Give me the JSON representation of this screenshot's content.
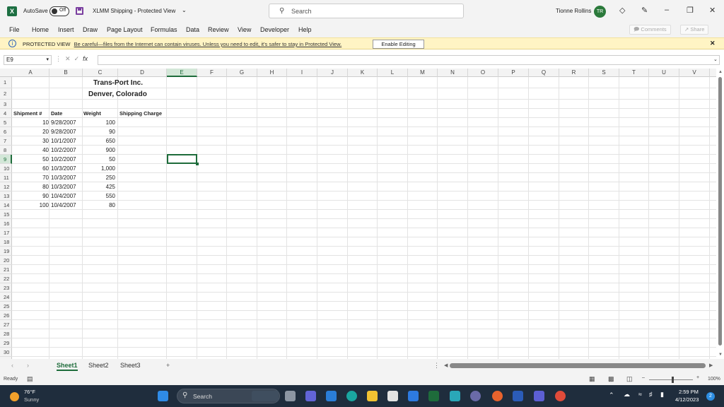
{
  "titlebar": {
    "app_icon": "X",
    "autosave_label": "AutoSave",
    "autosave_state": "Off",
    "doc_title": "XLMM Shipping  -  Protected View",
    "search_placeholder": "Search",
    "user_name": "Tionne Rollins",
    "user_initials": "TR"
  },
  "menu": {
    "items": [
      "File",
      "Home",
      "Insert",
      "Draw",
      "Page Layout",
      "Formulas",
      "Data",
      "Review",
      "View",
      "Developer",
      "Help"
    ],
    "comments": "Comments",
    "share": "Share"
  },
  "protected": {
    "label": "PROTECTED VIEW",
    "message": "Be careful—files from the Internet can contain viruses. Unless you need to edit, it's safer to stay in Protected View.",
    "button": "Enable Editing"
  },
  "formula": {
    "namebox": "E9",
    "fx": "fx",
    "value": ""
  },
  "grid": {
    "columns": [
      "A",
      "B",
      "C",
      "D",
      "E",
      "F",
      "G",
      "H",
      "I",
      "J",
      "K",
      "L",
      "M",
      "N",
      "O",
      "P",
      "Q",
      "R",
      "S",
      "T",
      "U",
      "V"
    ],
    "selected_column": "E",
    "selected_row": 9,
    "title1": "Trans-Port Inc.",
    "title2": "Denver, Colorado",
    "headers": {
      "a": "Shipment #",
      "b": "Date",
      "c": "Weight",
      "d": "Shipping Charge"
    },
    "rows": [
      {
        "a": "10",
        "b": "9/28/2007",
        "c": "100"
      },
      {
        "a": "20",
        "b": "9/28/2007",
        "c": "90"
      },
      {
        "a": "30",
        "b": "10/1/2007",
        "c": "650"
      },
      {
        "a": "40",
        "b": "10/2/2007",
        "c": "900"
      },
      {
        "a": "50",
        "b": "10/2/2007",
        "c": "50"
      },
      {
        "a": "60",
        "b": "10/3/2007",
        "c": "1,000"
      },
      {
        "a": "70",
        "b": "10/3/2007",
        "c": "250"
      },
      {
        "a": "80",
        "b": "10/3/2007",
        "c": "425"
      },
      {
        "a": "90",
        "b": "10/4/2007",
        "c": "550"
      },
      {
        "a": "100",
        "b": "10/4/2007",
        "c": "80"
      }
    ]
  },
  "sheets": {
    "tabs": [
      "Sheet1",
      "Sheet2",
      "Sheet3"
    ],
    "active": "Sheet1",
    "add": "+"
  },
  "status": {
    "ready": "Ready",
    "zoom": "100%"
  },
  "taskbar": {
    "temp": "76°F",
    "condition": "Sunny",
    "search": "Search",
    "time": "2:59 PM",
    "date": "4/12/2023",
    "notifications": "2"
  }
}
